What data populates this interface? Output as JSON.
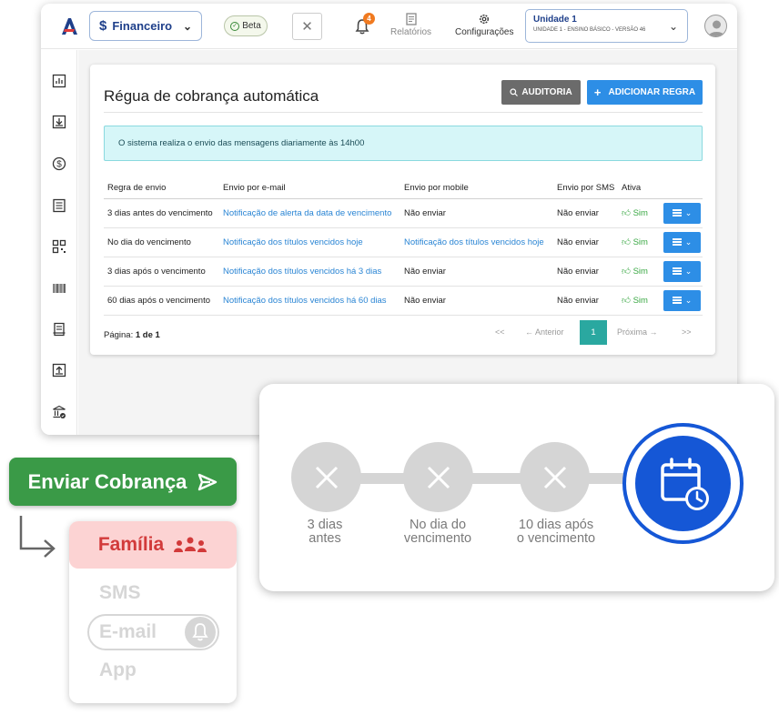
{
  "header": {
    "module_label": "Financeiro",
    "module_icon": "$",
    "beta_label": "Beta",
    "notification_count": "4",
    "nav": [
      {
        "label": "Relatórios",
        "icon": "report-icon"
      },
      {
        "label": "Configurações",
        "icon": "gear-icon"
      }
    ],
    "unit": {
      "name": "Unidade 1",
      "detail": "UNIDADE 1 - ENSINO BÁSICO - VERSÃO 46"
    }
  },
  "sidebar": {
    "icons": [
      "dashboard-icon",
      "download-box-icon",
      "dollar-circle-icon",
      "document-list-icon",
      "qr-code-icon",
      "barcode-icon",
      "receipt-icon",
      "upload-box-icon",
      "bank-check-icon"
    ]
  },
  "page": {
    "title": "Régua de cobrança automática",
    "audit_label": "AUDITORIA",
    "add_label": "ADICIONAR REGRA",
    "add_prefix": "+",
    "info_text": "O sistema realiza o envio das mensagens diariamente às 14h00"
  },
  "table": {
    "headers": [
      "Regra de envio",
      "Envio por e-mail",
      "Envio por mobile",
      "Envio por SMS",
      "Ativa"
    ],
    "rows": [
      {
        "rule": "3 dias antes do vencimento",
        "email": "Notificação de alerta da data de vencimento",
        "mobile": "Não enviar",
        "sms": "Não enviar",
        "active": "Sim"
      },
      {
        "rule": "No dia do vencimento",
        "email": "Notificação dos títulos vencidos hoje",
        "mobile": "Notificação dos títulos vencidos hoje",
        "sms": "Não enviar",
        "active": "Sim"
      },
      {
        "rule": "3 dias após o vencimento",
        "email": "Notificação dos títulos vencidos há 3 dias",
        "mobile": "Não enviar",
        "sms": "Não enviar",
        "active": "Sim"
      },
      {
        "rule": "60 dias após o vencimento",
        "email": "Notificação dos títulos vencidos há 60 dias",
        "mobile": "Não enviar",
        "sms": "Não enviar",
        "active": "Sim"
      }
    ]
  },
  "pagination": {
    "label": "Página:",
    "value": "1 de 1",
    "first": "<<",
    "prev": "← Anterior",
    "current": "1",
    "next": "Próxima →",
    "last": ">>"
  },
  "timeline": {
    "steps": [
      {
        "line1": "3 dias",
        "line2": "antes"
      },
      {
        "line1": "No dia do",
        "line2": "vencimento"
      },
      {
        "line1": "10 dias após",
        "line2": "o vencimento"
      }
    ],
    "final_icon": "calendar-clock-icon",
    "accent": "#1557d6"
  },
  "send": {
    "label": "Enviar Cobrança"
  },
  "channels": {
    "group_label": "Família",
    "items": [
      "SMS",
      "E-mail",
      "App"
    ]
  },
  "colors": {
    "primary": "#2d8ee6",
    "success": "#3a9a47",
    "family": "#d23a3a",
    "page_current": "#2aa8a0"
  }
}
